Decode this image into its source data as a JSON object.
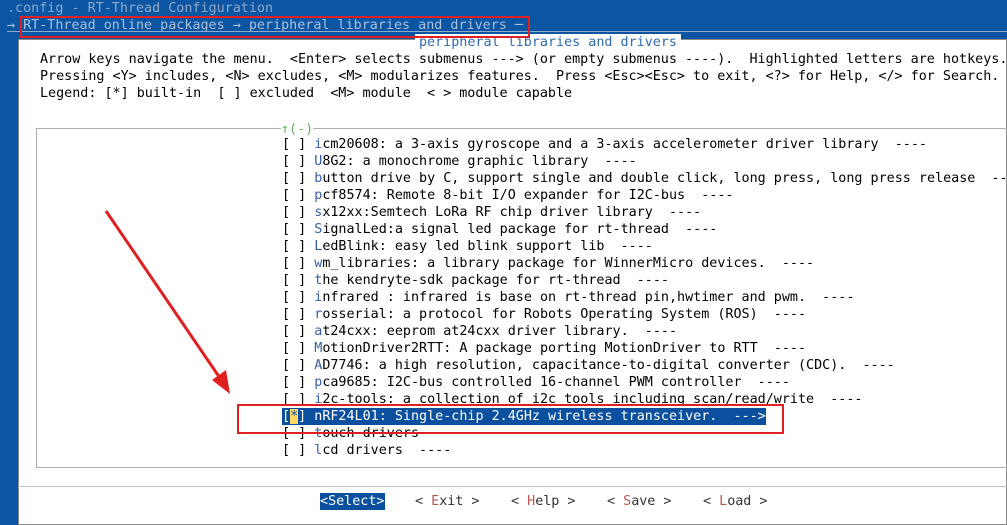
{
  "window": {
    "title": ".config - RT-Thread Configuration",
    "breadcrumb": "→ RT-Thread online packages → peripheral libraries and drivers ─"
  },
  "dialog": {
    "title": "peripheral libraries and drivers",
    "help": [
      "Arrow keys navigate the menu.  <Enter> selects submenus ---> (or empty submenus ----).  Highlighted letters are hotkeys.",
      "Pressing <Y> includes, <N> excludes, <M> modularizes features.  Press <Esc><Esc> to exit, <?> for Help, </> for Search.",
      "Legend: [*] built-in  [ ] excluded  <M> module  < > module capable"
    ],
    "scroll_indicator": "↑(-)"
  },
  "menu": {
    "items": [
      {
        "box": "[ ]",
        "hot": "i",
        "rest": "cm20608: a 3-axis gyroscope and a 3-axis accelerometer driver library  ----"
      },
      {
        "box": "[ ]",
        "hot": "U",
        "rest": "8G2: a monochrome graphic library  ----"
      },
      {
        "box": "[ ]",
        "hot": "b",
        "rest": "utton drive by C, support single and double click, long press, long press release  ----"
      },
      {
        "box": "[ ]",
        "hot": "p",
        "rest": "cf8574: Remote 8-bit I/O expander for I2C-bus  ----"
      },
      {
        "box": "[ ]",
        "hot": "s",
        "rest": "x12xx:Semtech LoRa RF chip driver library  ----"
      },
      {
        "box": "[ ]",
        "hot": "S",
        "rest": "ignalLed:a signal led package for rt-thread  ----"
      },
      {
        "box": "[ ]",
        "hot": "L",
        "rest": "edBlink: easy led blink support lib  ----"
      },
      {
        "box": "[ ]",
        "hot": "w",
        "rest": "m_libraries: a library package for WinnerMicro devices.  ----"
      },
      {
        "box": "[ ]",
        "hot": "t",
        "rest": "he kendryte-sdk package for rt-thread  ----"
      },
      {
        "box": "[ ]",
        "hot": "i",
        "rest": "nfrared : infrared is base on rt-thread pin,hwtimer and pwm.  ----"
      },
      {
        "box": "[ ]",
        "hot": "r",
        "rest": "osserial: a protocol for Robots Operating System (ROS)  ----"
      },
      {
        "box": "[ ]",
        "hot": "a",
        "rest": "t24cxx: eeprom at24cxx driver library.  ----"
      },
      {
        "box": "[ ]",
        "hot": "M",
        "rest": "otionDriver2RTT: A package porting MotionDriver to RTT  ----"
      },
      {
        "box": "[ ]",
        "hot": "A",
        "rest": "D7746: a high resolution, capacitance-to-digital converter (CDC).  ----"
      },
      {
        "box": "[ ]",
        "hot": "p",
        "rest": "ca9685: I2C-bus controlled 16-channel PWM controller  ----"
      },
      {
        "box": "[ ]",
        "hot": "i",
        "rest": "2c-tools: a collection of i2c tools including scan/read/write  ----"
      },
      {
        "box": "[*]",
        "hot": "n",
        "rest": "RF24L01: Single-chip 2.4GHz wireless transceiver.  --->"
      },
      {
        "box": "[ ]",
        "hot": "t",
        "rest": "ouch drivers  ----"
      },
      {
        "box": "[ ]",
        "hot": "l",
        "rest": "cd drivers  ----"
      }
    ],
    "selected_index": 16
  },
  "buttons": [
    {
      "pre": "<",
      "hot": "S",
      "rest": "elect>"
    },
    {
      "pre": "< ",
      "hot": "E",
      "rest": "xit >"
    },
    {
      "pre": "< ",
      "hot": "H",
      "rest": "elp >"
    },
    {
      "pre": "< ",
      "hot": "S",
      "rest": "ave >"
    },
    {
      "pre": "< ",
      "hot": "L",
      "rest": "oad >"
    }
  ],
  "colors": {
    "background": "#0b55a3",
    "selection": "#0b4f9f",
    "annotation": "#e02020"
  }
}
